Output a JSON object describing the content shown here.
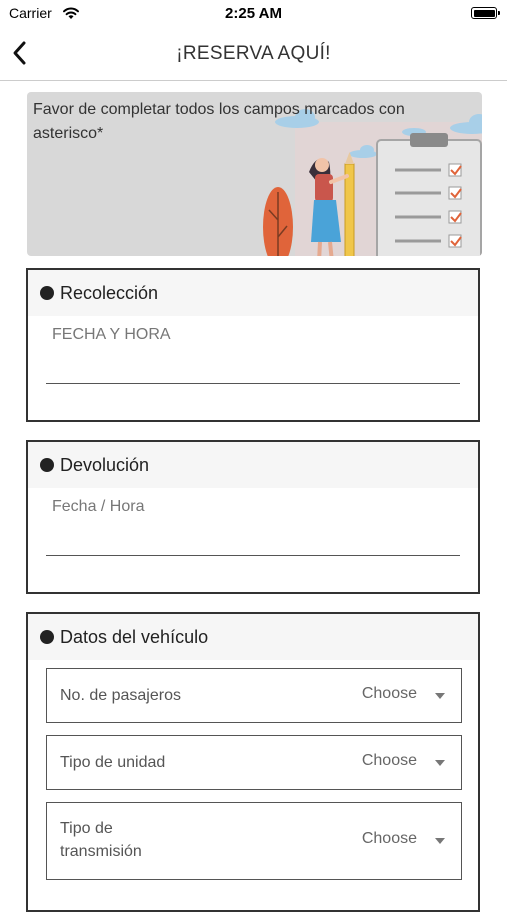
{
  "status_bar": {
    "carrier": "Carrier",
    "time": "2:25 AM"
  },
  "nav": {
    "title": "¡RESERVA AQUÍ!"
  },
  "banner": {
    "text": "Favor de completar todos los campos marcados con asterisco*"
  },
  "pickup": {
    "title": "Recolección",
    "placeholder": "FECHA Y HORA"
  },
  "return": {
    "title": "Devolución",
    "placeholder": "Fecha / Hora"
  },
  "vehicle": {
    "title": "Datos del vehículo",
    "fields": [
      {
        "label": "No. de pasajeros",
        "value": "Choose"
      },
      {
        "label": "Tipo de unidad",
        "value": "Choose"
      },
      {
        "label": "Tipo de transmisión",
        "value": "Choose"
      }
    ]
  },
  "colors": {
    "card_border": "#333333",
    "banner_bg": "#d8d8d8",
    "accent_orange": "#e0643a",
    "skirt_blue": "#4aa3d8"
  },
  "icons": {
    "back": "chevron-left-icon",
    "wifi": "wifi-icon",
    "battery": "battery-icon",
    "bullet": "bullet-dot-icon",
    "dropdown": "caret-down-icon"
  }
}
